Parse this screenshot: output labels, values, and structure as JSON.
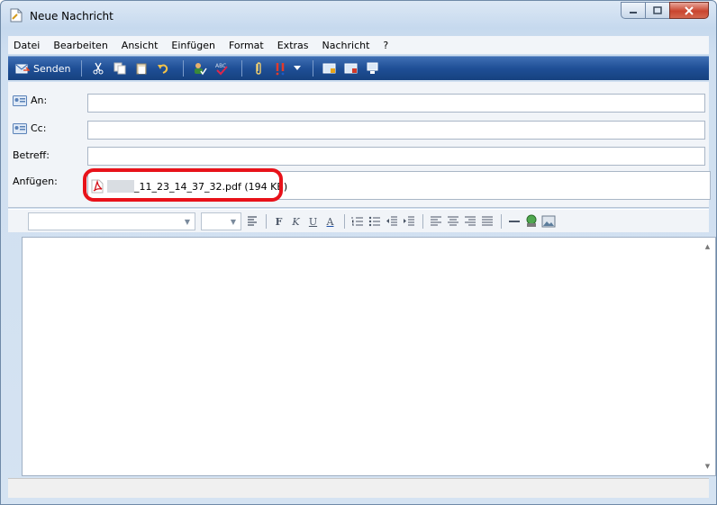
{
  "window": {
    "title": "Neue Nachricht"
  },
  "menubar": {
    "items": [
      {
        "label": "Datei"
      },
      {
        "label": "Bearbeiten"
      },
      {
        "label": "Ansicht"
      },
      {
        "label": "Einfügen"
      },
      {
        "label": "Format"
      },
      {
        "label": "Extras"
      },
      {
        "label": "Nachricht"
      },
      {
        "label": "?"
      }
    ]
  },
  "toolbar": {
    "send_label": "Senden",
    "icons": [
      "cut-icon",
      "copy-icon",
      "paste-icon",
      "undo-icon",
      "check-names-icon",
      "spelling-icon",
      "attach-icon",
      "priority-icon",
      "priority-dropdown-icon",
      "sign-icon",
      "encrypt-icon",
      "offline-icon"
    ]
  },
  "header": {
    "to_label": "An:",
    "cc_label": "Cc:",
    "subject_label": "Betreff:",
    "attach_label": "Anfügen:",
    "to_value": "",
    "cc_value": "",
    "subject_value": ""
  },
  "attachment": {
    "filename": "_11_23_14_37_32.pdf (194 KB)",
    "icon": "pdf-icon"
  },
  "format_toolbar": {
    "font_value": "",
    "size_value": "",
    "bold": "F",
    "italic": "K",
    "underline": "U",
    "font_color": "A"
  },
  "colors": {
    "accent": "#1f4f96",
    "highlight": "#e8121a"
  }
}
